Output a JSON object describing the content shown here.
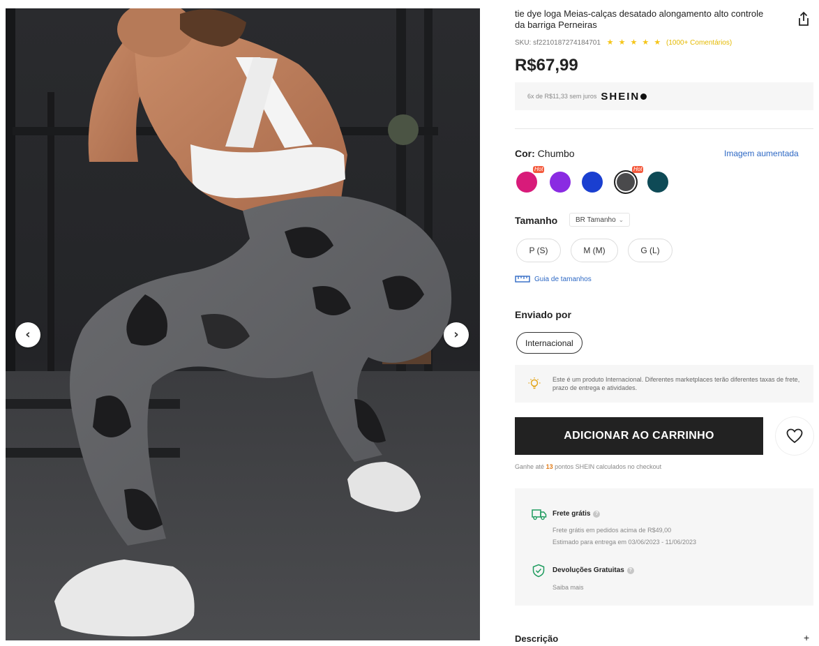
{
  "product": {
    "title": "tie dye loga Meias-calças desatado alongamento alto controle da barriga Perneiras",
    "sku": "SKU: sf2210187274184701",
    "stars": "★ ★ ★ ★ ★",
    "reviews": "(1000+ Comentários)",
    "price": "R$67,99"
  },
  "installment": {
    "text": "6x de R$11,33 sem juros",
    "brand": "SHEIN"
  },
  "color": {
    "label": "Cor:",
    "value": "Chumbo",
    "zoom_link": "Imagem aumentada",
    "hot_label": "Hot",
    "swatches": [
      {
        "color": "#d81b7a",
        "hot": true
      },
      {
        "color": "#8a2be2",
        "hot": false
      },
      {
        "color": "#1a3fd0",
        "hot": false
      },
      {
        "color": "#4a4a4c",
        "hot": true,
        "selected": true
      },
      {
        "color": "#0e4a56",
        "hot": false
      }
    ]
  },
  "size": {
    "label": "Tamanho",
    "dropdown": "BR Tamanho",
    "options": [
      "P (S)",
      "M (M)",
      "G (L)"
    ],
    "guide": "Guia de tamanhos"
  },
  "ship_from": {
    "label": "Enviado por",
    "option": "Internacional",
    "notice": "Este é um produto Internacional. Diferentes marketplaces terão diferentes taxas de frete, prazo de entrega e atividades."
  },
  "actions": {
    "add_to_cart": "ADICIONAR AO CARRINHO",
    "points_prefix": "Ganhe até",
    "points_value": "13",
    "points_suffix": "pontos SHEIN calculados no checkout"
  },
  "shipping": {
    "free_title": "Frete grátis",
    "free_line1": "Frete grátis em pedidos acima de R$49,00",
    "free_line2": "Estimado para entrega em 03/06/2023 - 11/06/2023",
    "returns_title": "Devoluções Gratuitas",
    "returns_link": "Saiba mais"
  },
  "description": {
    "label": "Descrição",
    "toggle": "+"
  },
  "icons": {
    "prev": "chevron-left-icon",
    "next": "chevron-right-icon",
    "share": "share-icon",
    "heart": "heart-icon",
    "ruler": "ruler-icon",
    "bulb": "lightbulb-icon",
    "truck": "truck-icon",
    "shield": "shield-check-icon"
  },
  "colors": {
    "link_blue": "#2d68c4",
    "button_dark": "#222222",
    "star_yellow": "#f5c518"
  }
}
